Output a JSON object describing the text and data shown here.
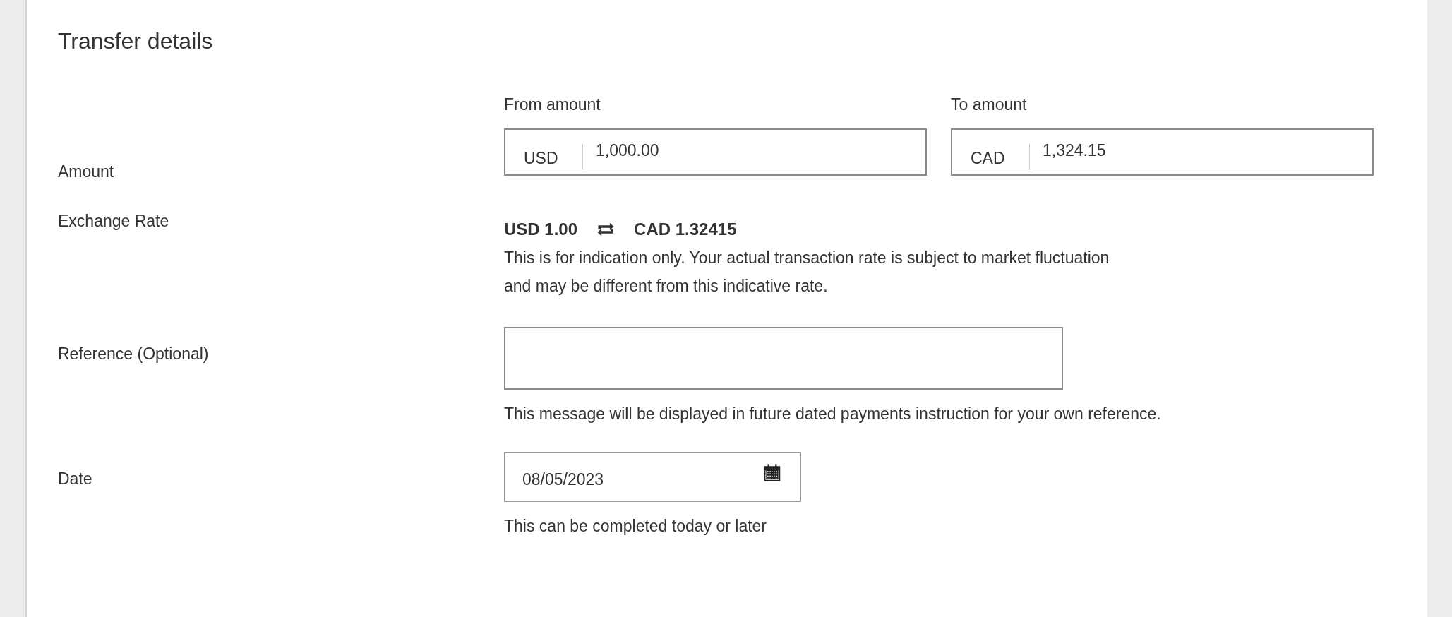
{
  "title": "Transfer details",
  "rows": [
    {
      "kind": "amount",
      "label": "Amount",
      "fields": [
        {
          "heading": "From amount",
          "currency": "USD",
          "value": "1,000.00"
        },
        {
          "heading": "To amount",
          "currency": "CAD",
          "value": "1,324.15"
        }
      ]
    },
    {
      "kind": "rate",
      "label": "Exchange Rate",
      "from": "USD 1.00",
      "to": "CAD 1.32415",
      "note_lines": [
        "This is for indication only. Your actual transaction rate is subject to market fluctuation",
        "and may be different from this indicative rate."
      ]
    },
    {
      "kind": "text",
      "label": "Reference (Optional)",
      "help": "This message will be displayed in future dated payments instruction for your own reference."
    },
    {
      "kind": "date",
      "label": "Date",
      "value": "08/05/2023",
      "help": "This can be completed today or later"
    }
  ]
}
